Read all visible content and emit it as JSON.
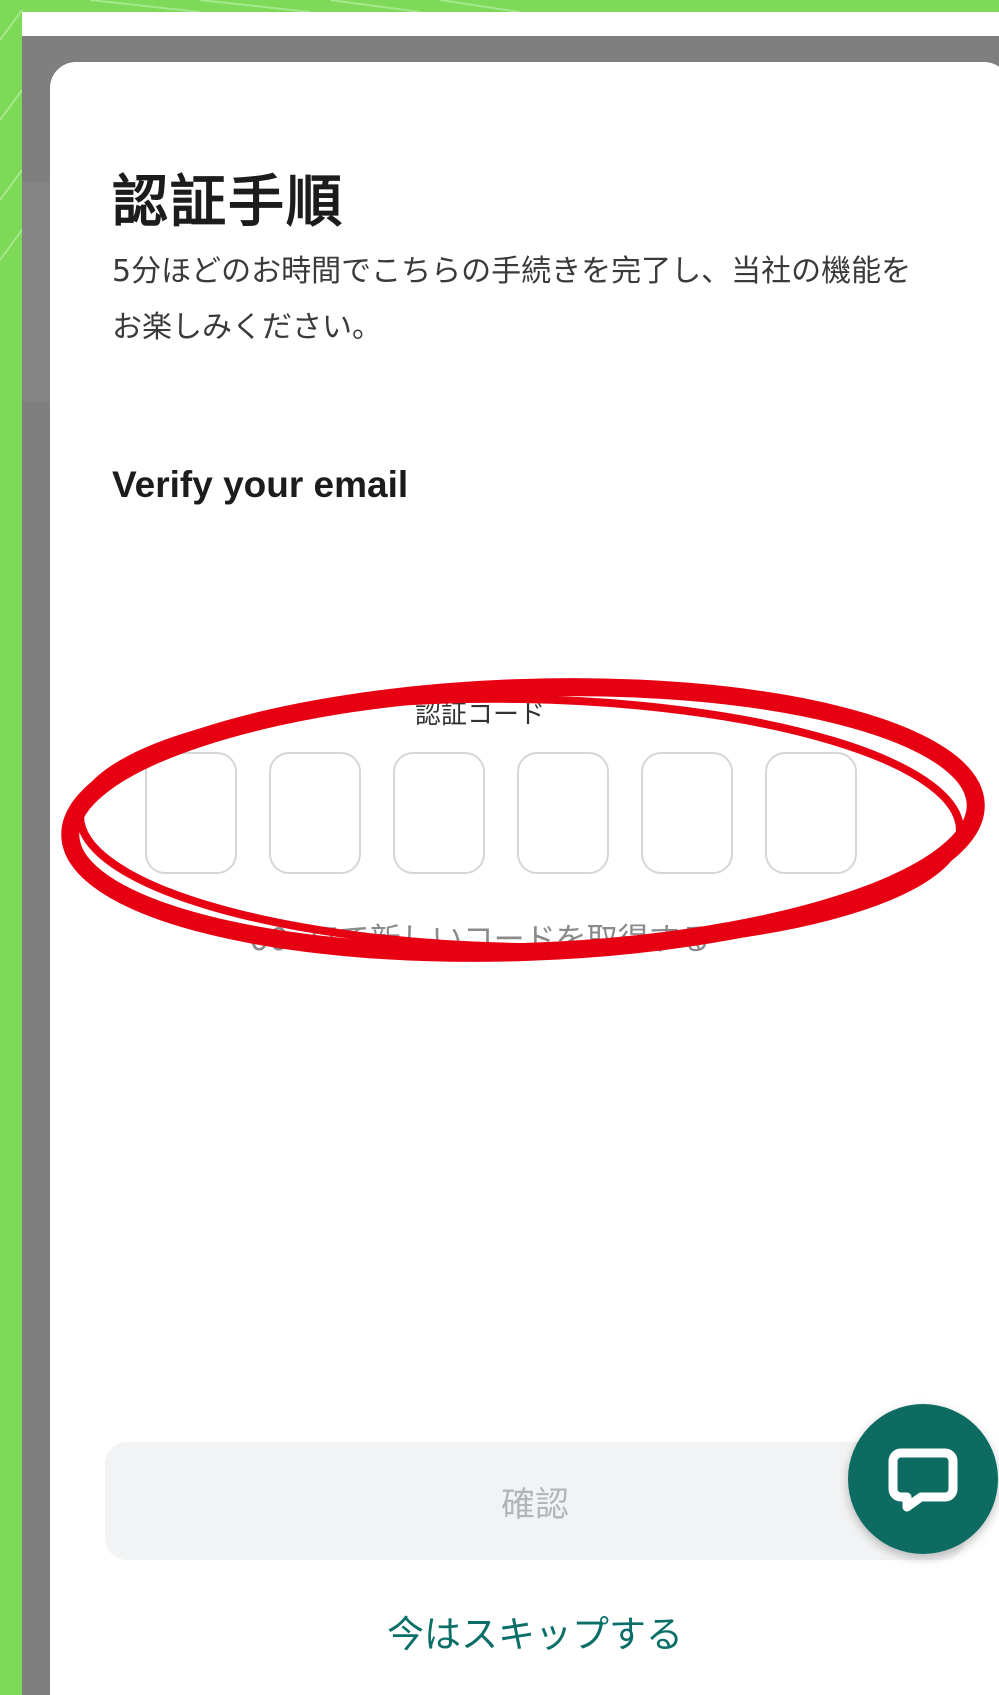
{
  "modal": {
    "title": "認証手順",
    "description": "5分ほどのお時間でこちらの手続きを完了し、当社の機能をお楽しみください。",
    "section_title": "Verify your email",
    "code_label": "認証コード",
    "code_inputs": [
      "",
      "",
      "",
      "",
      "",
      ""
    ],
    "resend_text": "00:37で新しいコードを取得する",
    "confirm_label": "確認",
    "skip_label": "今はスキップする"
  },
  "icons": {
    "chat": "chat-bubble-icon"
  },
  "colors": {
    "frame_green": "#7dd957",
    "brand_teal": "#0e6b62",
    "link_teal": "#0b6f68",
    "annotation_red": "#e60012",
    "disabled_button_bg": "#f2f3f4",
    "disabled_button_text": "#b3b6b9"
  }
}
